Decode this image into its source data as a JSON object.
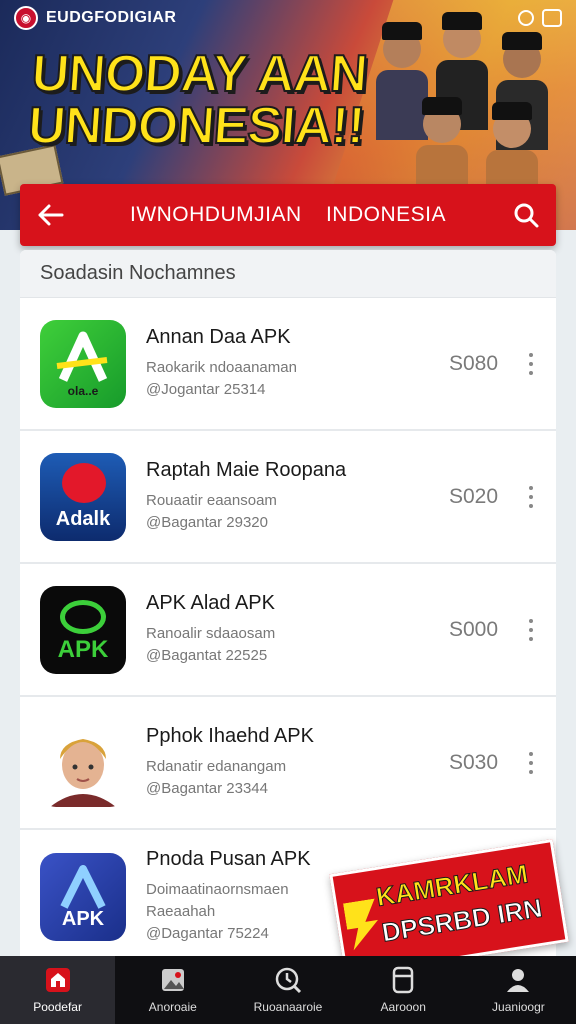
{
  "banner": {
    "brand": "EUDGFODIGIAR",
    "headline_line1": "UNODAY AAN",
    "headline_line2": "UNDONESIA!!"
  },
  "appbar": {
    "title": "IWNOHDUMJIAN INDONESIA",
    "back_icon": "arrow-left-icon",
    "search_icon": "search-icon"
  },
  "section": {
    "title": "Soadasin Nochamnes"
  },
  "apps": [
    {
      "name": "Annan Daa APK",
      "line1": "Raokarik ndoaanaman",
      "line2": "@Jogantar 25314",
      "price": "S080",
      "icon_text": "ola..e"
    },
    {
      "name": "Raptah Maie Roopana",
      "line1": "Rouaatir eaansoam",
      "line2": "@Bagantar 29320",
      "price": "S020",
      "icon_text": "Adalk"
    },
    {
      "name": "APK Alad APK",
      "line1": "Ranoalir sdaaosam",
      "line2": "@Bagantat 22525",
      "price": "S000",
      "icon_text": "APK"
    },
    {
      "name": "Pphok Ihaehd APK",
      "line1": "Rdanatir edanangam",
      "line2": "@Bagantar 23344",
      "price": "S030",
      "icon_text": ""
    },
    {
      "name": "Pnoda Pusan APK",
      "line1": "Doimaatinaornsmaen",
      "line2": "Raeaahah",
      "line3": "@Dagantar 75224",
      "price": "",
      "icon_text": "APK"
    }
  ],
  "promo": {
    "line1": "KAMRKLAM",
    "line2": "DPSRBD IRN"
  },
  "nav": [
    {
      "label": "Poodefar",
      "icon": "home-icon"
    },
    {
      "label": "Anoroaie",
      "icon": "image-icon"
    },
    {
      "label": "Ruoanaaroie",
      "icon": "clock-search-icon"
    },
    {
      "label": "Aarooon",
      "icon": "device-icon"
    },
    {
      "label": "Juanioogr",
      "icon": "profile-icon"
    }
  ],
  "colors": {
    "accent_red": "#d7121b",
    "headline_yellow": "#ffe21a",
    "nav_background": "#0f0f12"
  }
}
